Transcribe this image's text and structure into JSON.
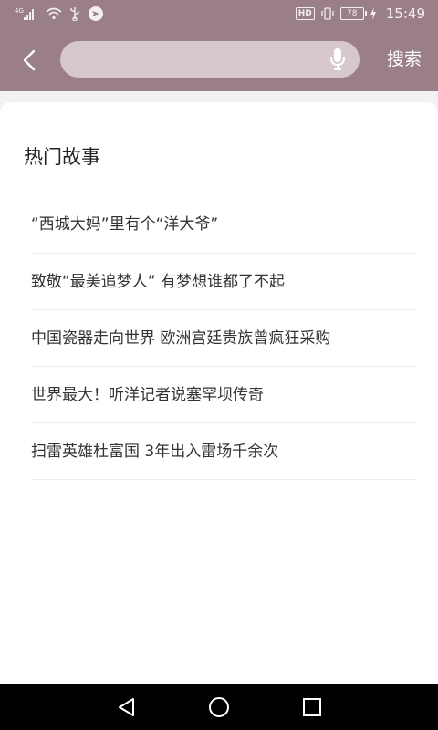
{
  "status_bar": {
    "network": "4G",
    "time": "15:49",
    "hd_label": "HD",
    "battery_level": "78"
  },
  "header": {
    "search_placeholder": "",
    "search_button": "搜索"
  },
  "section": {
    "title": "热门故事"
  },
  "stories": [
    "“西城大妈”里有个“洋大爷”",
    "致敬“最美追梦人” 有梦想谁都了不起",
    "中国瓷器走向世界 欧洲宫廷贵族曾疯狂采购",
    "世界最大！听洋记者说塞罕坝传奇",
    "扫雷英雄杜富国 3年出入雷场千余次"
  ],
  "colors": {
    "header_bg": "#9a7f86",
    "search_bg": "#d6c8cc",
    "page_bg": "#f4f1f3",
    "card_bg": "#ffffff"
  },
  "icons": {
    "back": "chevron-left-icon",
    "mic": "microphone-icon",
    "nav_back": "triangle-back-icon",
    "nav_home": "circle-home-icon",
    "nav_recent": "square-recent-icon"
  }
}
